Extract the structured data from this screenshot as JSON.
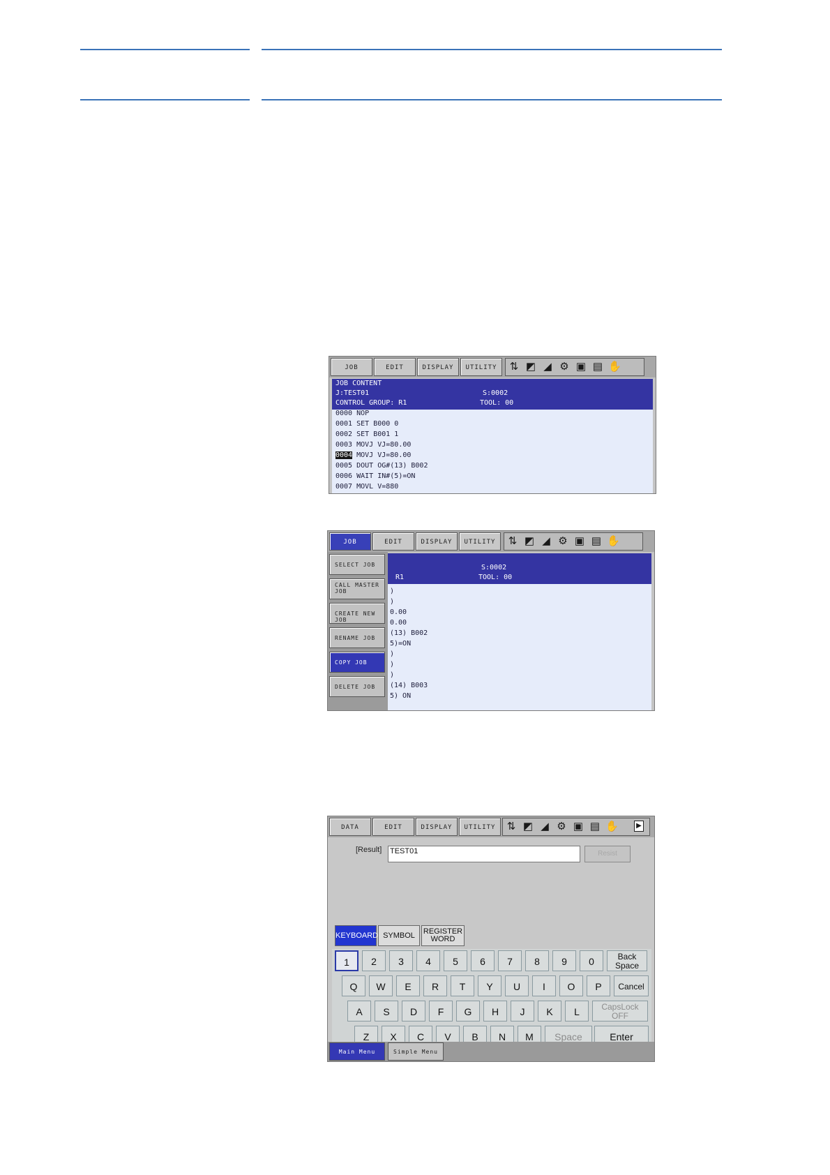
{
  "screen1": {
    "tabs": [
      "JOB",
      "EDIT",
      "DISPLAY",
      "UTILITY"
    ],
    "header": {
      "title": "JOB CONTENT",
      "job": "J:TEST01",
      "step": "S:0002",
      "group": "CONTROL GROUP: R1",
      "tool": "TOOL: 00"
    },
    "lines": [
      {
        "no": "0000",
        "text": "NOP"
      },
      {
        "no": "0001",
        "text": "SET B000 0"
      },
      {
        "no": "0002",
        "text": "SET B001 1"
      },
      {
        "no": "0003",
        "text": "MOVJ VJ=80.00"
      },
      {
        "no": "0004",
        "text": "MOVJ VJ=80.00"
      },
      {
        "no": "0005",
        "text": "DOUT OG#(13) B002"
      },
      {
        "no": "0006",
        "text": "WAIT IN#(5)=ON"
      },
      {
        "no": "0007",
        "text": "MOVL V=880"
      }
    ]
  },
  "screen2": {
    "tabs": [
      "JOB",
      "EDIT",
      "DISPLAY",
      "UTILITY"
    ],
    "header": {
      "step": "S:0002",
      "group": "R1",
      "tool": "TOOL: 00"
    },
    "menu": [
      "SELECT JOB",
      "CALL MASTER\nJOB",
      "CREATE NEW JOB",
      "RENAME JOB",
      "COPY JOB",
      "DELETE JOB"
    ],
    "lines": [
      ")",
      ")",
      "0.00",
      "0.00",
      "(13) B002",
      "5)=ON",
      ")",
      ")",
      ")",
      "(14) B003",
      "5) ON"
    ]
  },
  "screen3": {
    "tabs": [
      "DATA",
      "EDIT",
      "DISPLAY",
      "UTILITY"
    ],
    "result_label": "[Result]",
    "result_value": "TEST01",
    "resist_label": "Resist",
    "modes": [
      "KEYBOARD",
      "SYMBOL",
      "REGISTER\nWORD"
    ],
    "row1": [
      "1",
      "2",
      "3",
      "4",
      "5",
      "6",
      "7",
      "8",
      "9",
      "0"
    ],
    "row2": [
      "Q",
      "W",
      "E",
      "R",
      "T",
      "Y",
      "U",
      "I",
      "O",
      "P"
    ],
    "row3": [
      "A",
      "S",
      "D",
      "F",
      "G",
      "H",
      "J",
      "K",
      "L"
    ],
    "row4": [
      "Z",
      "X",
      "C",
      "V",
      "B",
      "N",
      "M"
    ],
    "backspace": "Back\nSpace",
    "cancel": "Cancel",
    "capslock": "CapsLock\nOFF",
    "space": "Space",
    "enter": "Enter",
    "bottom": [
      "Main Menu",
      "Simple Menu"
    ]
  },
  "colors": {
    "rule": "#3a73b8",
    "header": "#3434a2",
    "body": "#e6ecfa",
    "active_tab": "#3840b8"
  },
  "icons": [
    "arrows-icon",
    "help-icon",
    "signal-icon",
    "robot-icon",
    "camera-icon",
    "display-icon",
    "hand-icon"
  ]
}
